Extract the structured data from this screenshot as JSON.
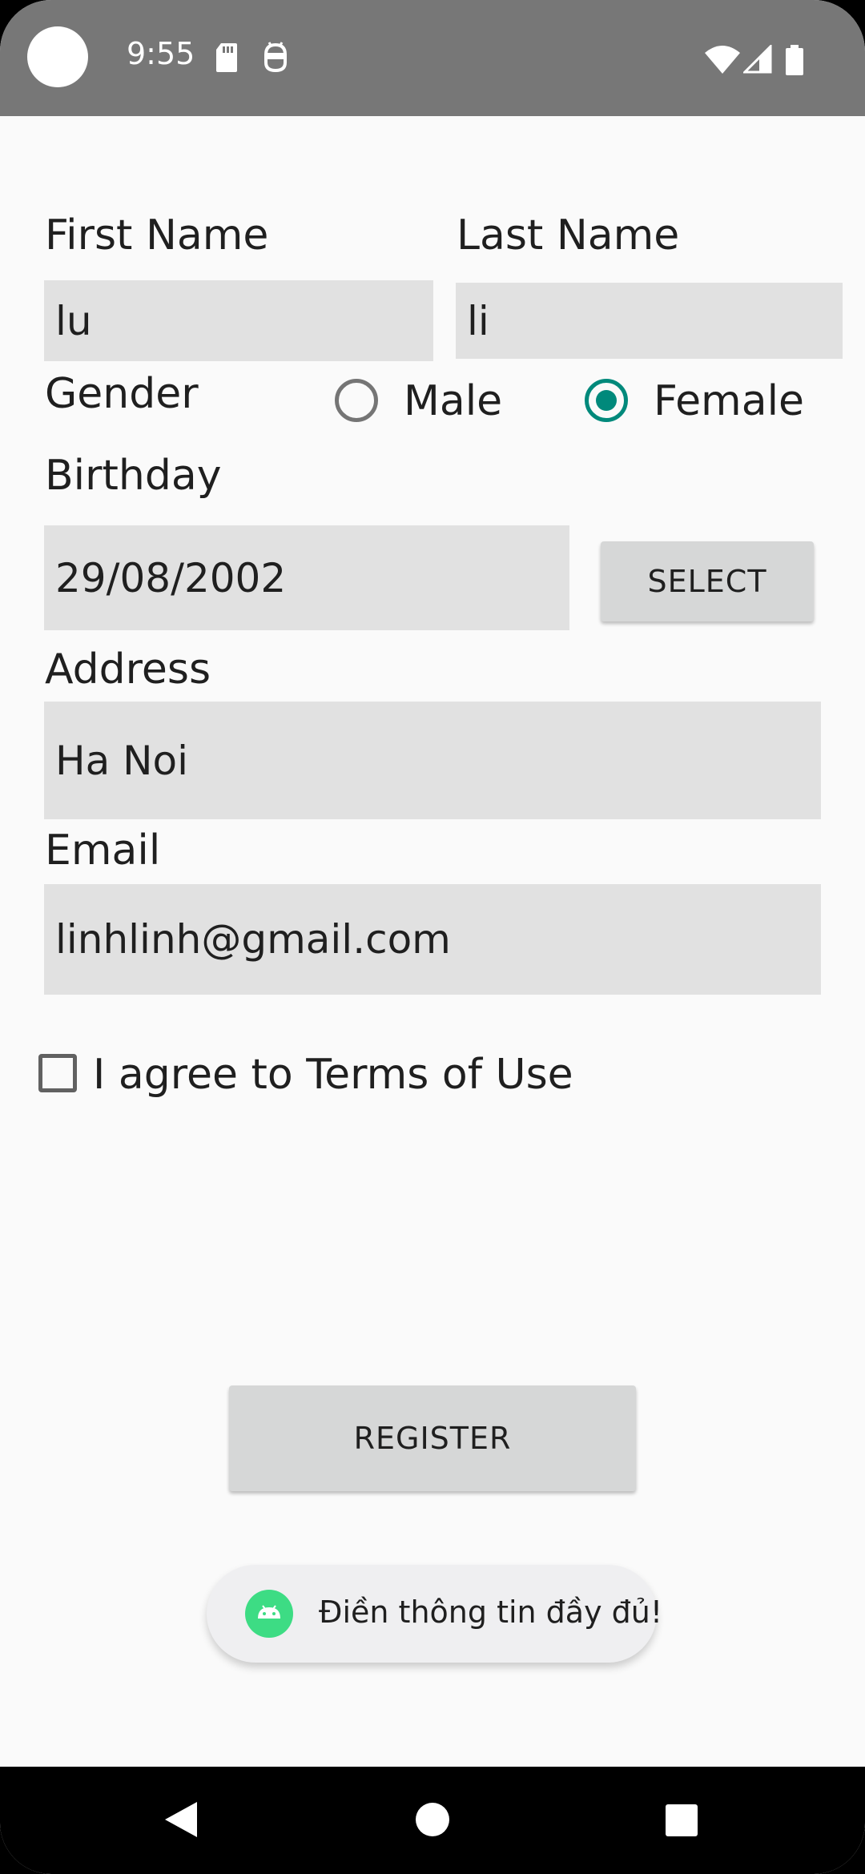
{
  "status_bar": {
    "time": "9:55",
    "icons": [
      "sd-card-icon",
      "android-debug-icon",
      "wifi-icon",
      "signal-icon",
      "battery-icon"
    ]
  },
  "form": {
    "first_name": {
      "label": "First Name",
      "value": "lu"
    },
    "last_name": {
      "label": "Last Name",
      "value": "li"
    },
    "gender": {
      "label": "Gender",
      "options": [
        {
          "label": "Male",
          "selected": false
        },
        {
          "label": "Female",
          "selected": true
        }
      ]
    },
    "birthday": {
      "label": "Birthday",
      "value": "29/08/2002",
      "select_label": "SELECT"
    },
    "address": {
      "label": "Address",
      "value": "Ha Noi"
    },
    "email": {
      "label": "Email",
      "value": "linhlinh@gmail.com"
    },
    "terms": {
      "label": "I agree to Terms of Use",
      "checked": false
    }
  },
  "register_label": "REGISTER",
  "toast": {
    "message": "Điền thông tin đầy đủ!"
  },
  "colors": {
    "accent": "#00897b",
    "status_bar": "#777777",
    "field_bg": "#e1e1e1",
    "button_bg": "#d6d7d7"
  }
}
